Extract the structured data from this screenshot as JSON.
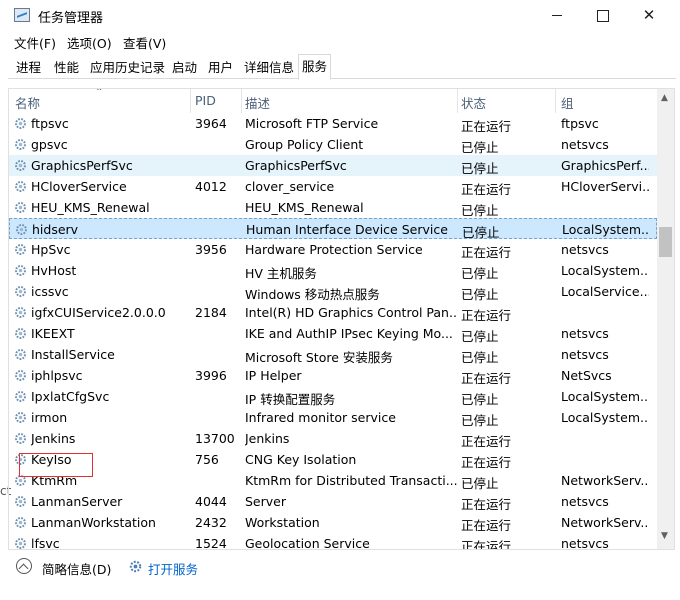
{
  "window": {
    "title": "任务管理器"
  },
  "menu": [
    "文件(F)",
    "选项(O)",
    "查看(V)"
  ],
  "tabs": [
    "进程",
    "性能",
    "应用历史记录",
    "启动",
    "用户",
    "详细信息",
    "服务"
  ],
  "columns": {
    "name": "名称",
    "pid": "PID",
    "desc": "描述",
    "status": "状态",
    "group": "组"
  },
  "rows": [
    {
      "name": "ftpsvc",
      "pid": "3964",
      "desc": "Microsoft FTP Service",
      "status": "正在运行",
      "group": "ftpsvc"
    },
    {
      "name": "gpsvc",
      "pid": "",
      "desc": "Group Policy Client",
      "status": "已停止",
      "group": "netsvcs"
    },
    {
      "name": "GraphicsPerfSvc",
      "pid": "",
      "desc": "GraphicsPerfSvc",
      "status": "已停止",
      "group": "GraphicsPerf..."
    },
    {
      "name": "HCloverService",
      "pid": "4012",
      "desc": "clover_service",
      "status": "正在运行",
      "group": "HCloverServi..."
    },
    {
      "name": "HEU_KMS_Renewal",
      "pid": "",
      "desc": "HEU_KMS_Renewal",
      "status": "已停止",
      "group": ""
    },
    {
      "name": "hidserv",
      "pid": "",
      "desc": "Human Interface Device Service",
      "status": "已停止",
      "group": "LocalSystem..."
    },
    {
      "name": "HpSvc",
      "pid": "3956",
      "desc": "Hardware Protection Service",
      "status": "正在运行",
      "group": "netsvcs"
    },
    {
      "name": "HvHost",
      "pid": "",
      "desc": "HV 主机服务",
      "status": "已停止",
      "group": "LocalSystem..."
    },
    {
      "name": "icssvc",
      "pid": "",
      "desc": "Windows 移动热点服务",
      "status": "已停止",
      "group": "LocalService..."
    },
    {
      "name": "igfxCUIService2.0.0.0",
      "pid": "2184",
      "desc": "Intel(R) HD Graphics Control Pan...",
      "status": "正在运行",
      "group": ""
    },
    {
      "name": "IKEEXT",
      "pid": "",
      "desc": "IKE and AuthIP IPsec Keying Mo...",
      "status": "已停止",
      "group": "netsvcs"
    },
    {
      "name": "InstallService",
      "pid": "",
      "desc": "Microsoft Store 安装服务",
      "status": "已停止",
      "group": "netsvcs"
    },
    {
      "name": "iphlpsvc",
      "pid": "3996",
      "desc": "IP Helper",
      "status": "正在运行",
      "group": "NetSvcs"
    },
    {
      "name": "IpxlatCfgSvc",
      "pid": "",
      "desc": "IP 转换配置服务",
      "status": "已停止",
      "group": "LocalSystem..."
    },
    {
      "name": "irmon",
      "pid": "",
      "desc": "Infrared monitor service",
      "status": "已停止",
      "group": "LocalSystem..."
    },
    {
      "name": "Jenkins",
      "pid": "13700",
      "desc": "Jenkins",
      "status": "正在运行",
      "group": ""
    },
    {
      "name": "KeyIso",
      "pid": "756",
      "desc": "CNG Key Isolation",
      "status": "正在运行",
      "group": ""
    },
    {
      "name": "KtmRm",
      "pid": "",
      "desc": "KtmRm for Distributed Transacti...",
      "status": "已停止",
      "group": "NetworkServ..."
    },
    {
      "name": "LanmanServer",
      "pid": "4044",
      "desc": "Server",
      "status": "正在运行",
      "group": "netsvcs"
    },
    {
      "name": "LanmanWorkstation",
      "pid": "2432",
      "desc": "Workstation",
      "status": "正在运行",
      "group": "NetworkServ..."
    },
    {
      "name": "lfsvc",
      "pid": "1524",
      "desc": "Geolocation Service",
      "status": "正在运行",
      "group": "netsvcs"
    }
  ],
  "footer": {
    "collapse": "简略信息(D)",
    "open_services": "打开服务"
  },
  "left_edge_fragment": "ct",
  "colors": {
    "selected": "#cce8ff",
    "hover": "#e5f3fb",
    "link": "#0066cc",
    "annotation": "#e03030"
  },
  "icons": {
    "app": "task-manager-icon",
    "service": "gear-icon",
    "collapse": "chevron-up-circle-icon",
    "open": "services-gear-icon"
  }
}
